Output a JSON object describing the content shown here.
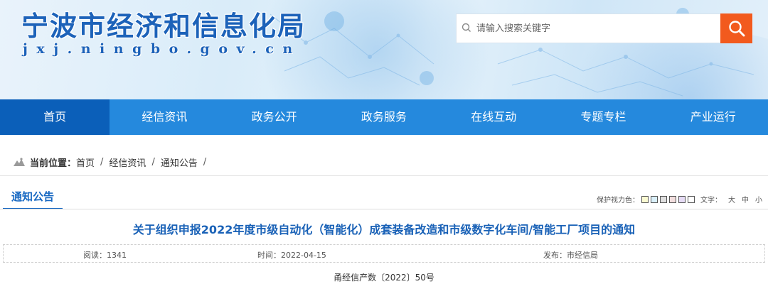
{
  "header": {
    "site_title": "宁波市经济和信息化局",
    "site_domain": "jxj.ningbo.gov.cn",
    "search_placeholder": "请输入搜索关键字"
  },
  "nav": {
    "items": [
      {
        "label": "首页",
        "active": true
      },
      {
        "label": "经信资讯",
        "active": false
      },
      {
        "label": "政务公开",
        "active": false
      },
      {
        "label": "政务服务",
        "active": false
      },
      {
        "label": "在线互动",
        "active": false
      },
      {
        "label": "专题专栏",
        "active": false
      },
      {
        "label": "产业运行",
        "active": false
      }
    ]
  },
  "breadcrumb": {
    "label": "当前位置：",
    "items": [
      "首页",
      "经信资讯",
      "通知公告"
    ],
    "separator": "/"
  },
  "section": {
    "title": "通知公告"
  },
  "tools": {
    "eye_care_label": "保护视力色：",
    "swatches": [
      "#fafad2",
      "#daf0fa",
      "#e0e0e0",
      "#f2dede",
      "#e6dcf5",
      "#ffffff"
    ],
    "font_label": "文字：",
    "sizes": [
      "大",
      "中",
      "小"
    ]
  },
  "article": {
    "title": "关于组织申报2022年度市级自动化（智能化）成套装备改造和市级数字化车间/智能工厂项目的通知",
    "reads_label": "阅读：1341",
    "time_label": "时间：2022-04-15",
    "publisher_label": "发布：市经信局",
    "doc_number": "甬经信产数〔2022〕50号"
  },
  "colors": {
    "nav_bg": "#2589dd",
    "nav_active": "#0b5fb9",
    "search_button": "#f25a1e",
    "title_blue": "#1a62b7"
  }
}
